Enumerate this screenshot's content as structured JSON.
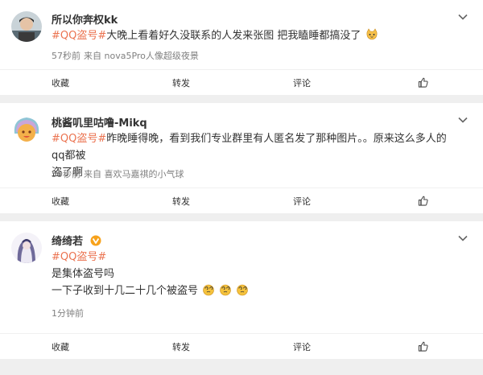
{
  "posts": [
    {
      "username": "所以你奔权kk",
      "hashtag": "#QQ盗号#",
      "text": "大晚上看着好久没联系的人发来张图 把我瞌睡都搞没了",
      "emoji": "cat-face-emoji",
      "time": "57秒前",
      "source": "来自 nova5Pro人像超级夜景",
      "actions": {
        "collect": "收藏",
        "repost": "转发",
        "comment": "评论",
        "like_icon": "thumbs-up-icon"
      }
    },
    {
      "username": "桃酱叽里咕噜-Mikq",
      "hashtag": "#QQ盗号#",
      "text_line1": "昨晚睡得晚，看到我们专业群里有人匿名发了那种图片。。原来这么多人的qq都被",
      "text_line2": "盗了啊",
      "time": "59秒前",
      "source": "来自 喜欢马嘉祺的小气球",
      "actions": {
        "collect": "收藏",
        "repost": "转发",
        "comment": "评论",
        "like_icon": "thumbs-up-icon"
      }
    },
    {
      "username": "绮绮若",
      "badge_icon": "verified-badge-icon",
      "hashtag": "#QQ盗号#",
      "text_line1": "是集体盗号吗",
      "text_line2": "一下子收到十几二十几个被盗号",
      "emoji": "dizzy-face-emoji",
      "time": "1分钟前",
      "actions": {
        "collect": "收藏",
        "repost": "转发",
        "comment": "评论",
        "like_icon": "thumbs-up-icon"
      }
    }
  ],
  "colors": {
    "hashtag": "#eb7350",
    "meta": "#808080",
    "background": "#efefef"
  }
}
